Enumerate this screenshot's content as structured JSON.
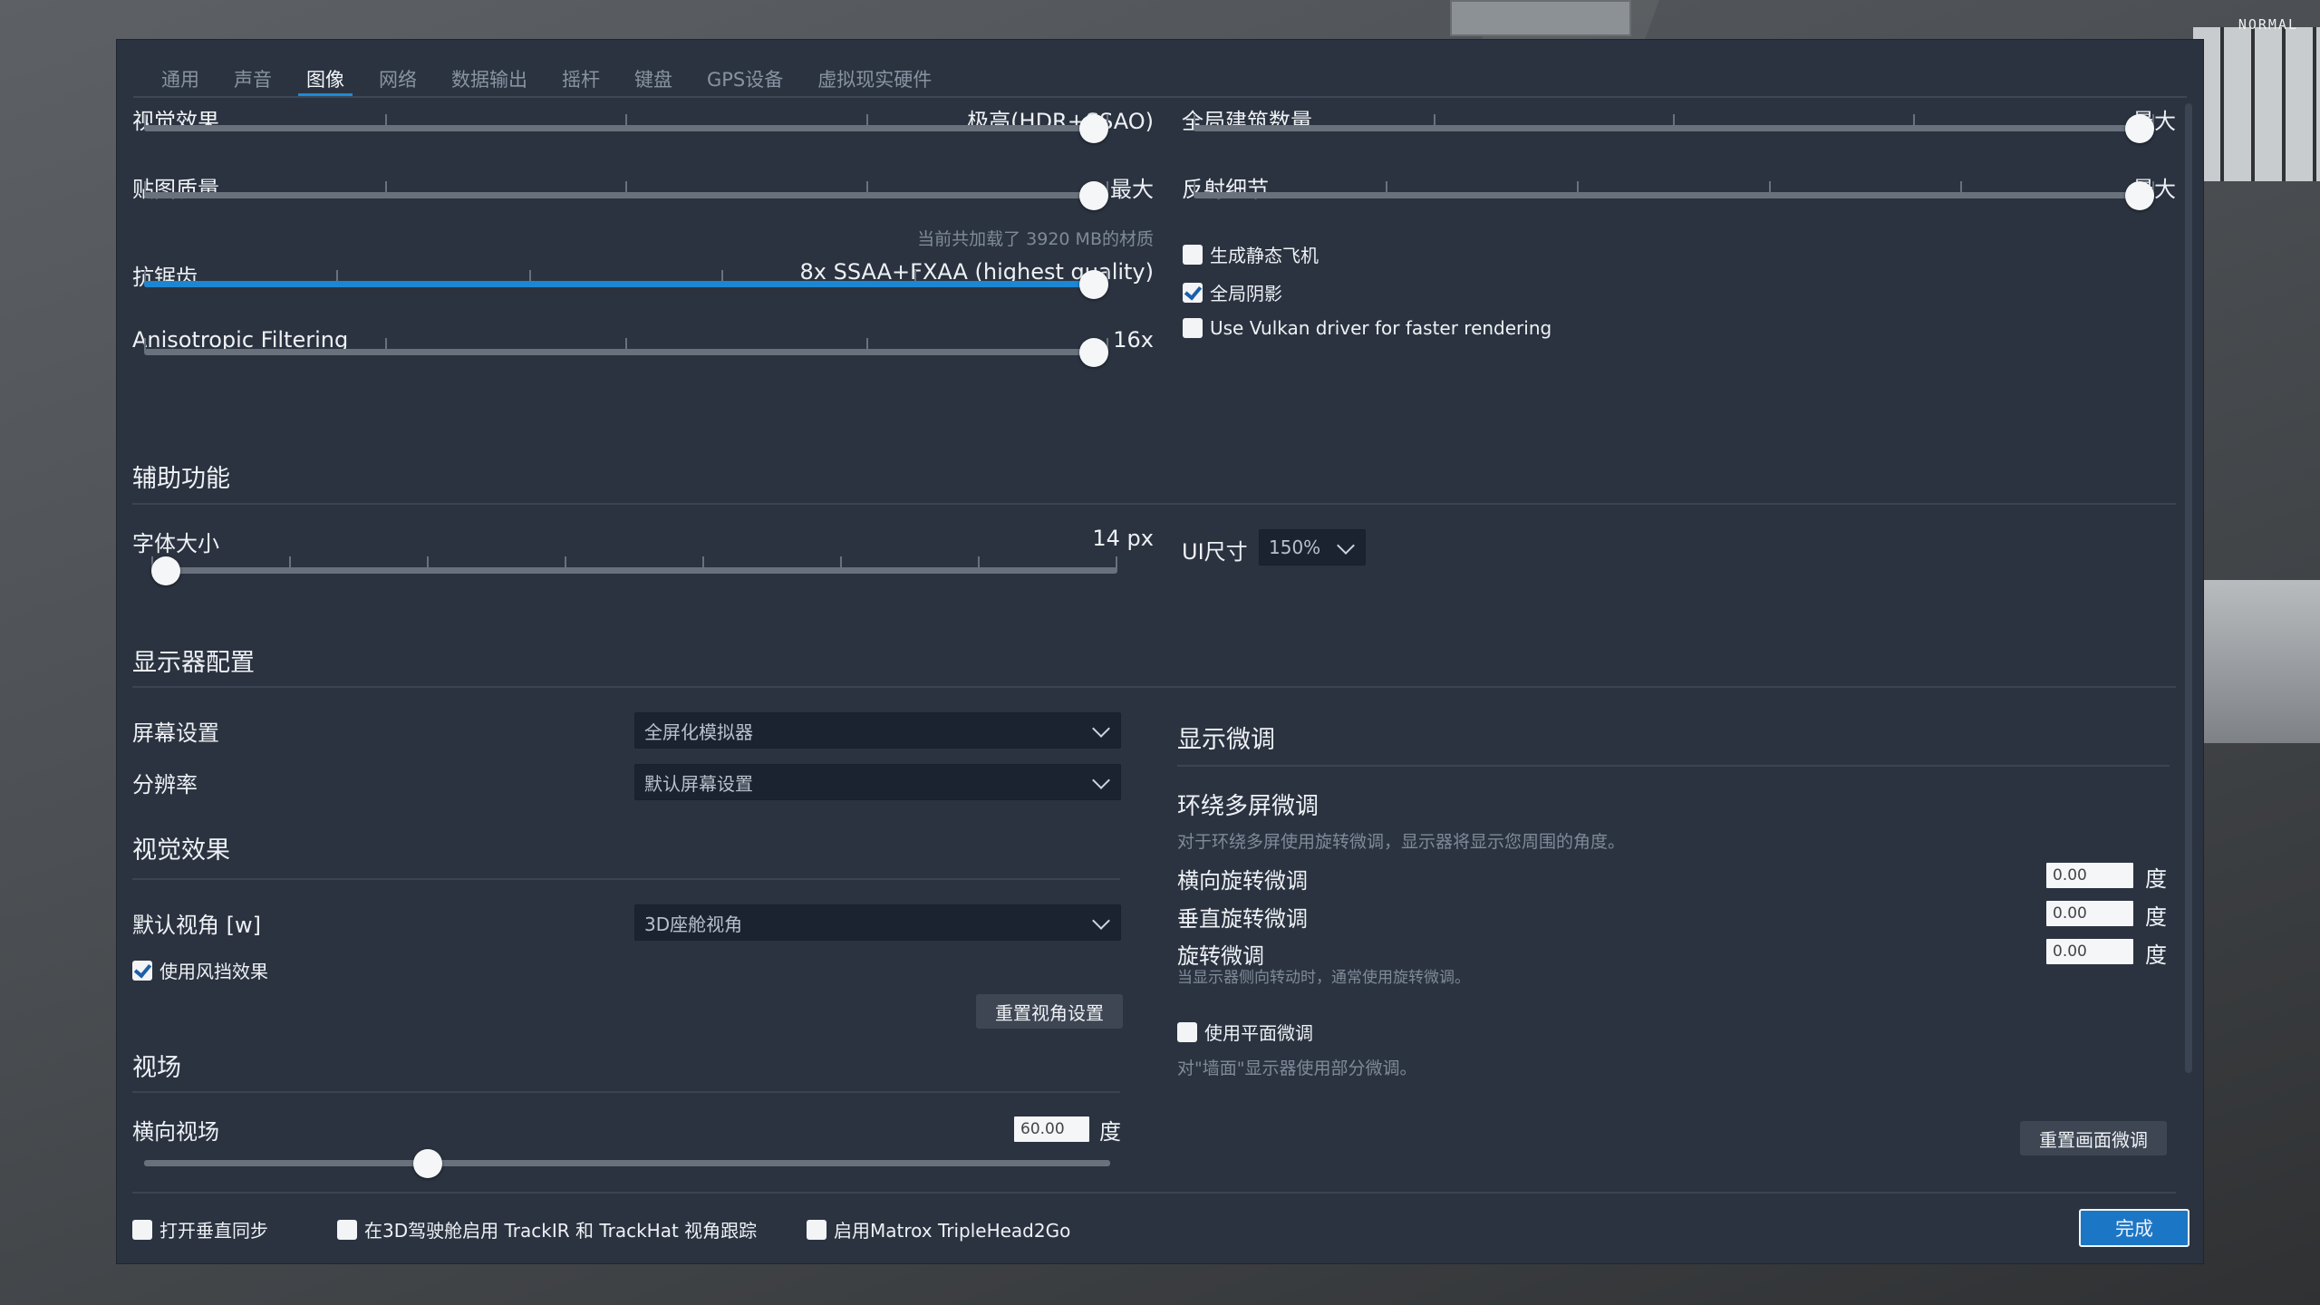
{
  "overlay_label": "NORMAL",
  "tabs": [
    "通用",
    "声音",
    "图像",
    "网络",
    "数据输出",
    "摇杆",
    "键盘",
    "GPS设备",
    "虚拟现实硬件"
  ],
  "active_tab": "图像",
  "graphics": {
    "visual_effects": {
      "label": "视觉效果",
      "value": "极高(HDR+SSAO)",
      "level": 1.0
    },
    "texture_quality": {
      "label": "贴图质量",
      "value": "最大",
      "level": 1.0
    },
    "texture_note": "当前共加载了 3920 MB的材质",
    "antialiasing": {
      "label": "抗锯齿",
      "value": "8x SSAA+FXAA (highest quality)",
      "level": 1.0
    },
    "anisotropic": {
      "label": "Anisotropic Filtering",
      "value": "16x",
      "level": 1.0
    },
    "world_objects": {
      "label": "全局建筑数量",
      "value": "最大",
      "level": 1.0
    },
    "reflection_detail": {
      "label": "反射细节",
      "value": "最大",
      "level": 1.0
    },
    "checks": [
      {
        "label": "生成静态飞机",
        "checked": false
      },
      {
        "label": "全局阴影",
        "checked": true
      },
      {
        "label": "Use Vulkan driver for faster rendering",
        "checked": false
      }
    ]
  },
  "accessibility": {
    "title": "辅助功能",
    "font_size": {
      "label": "字体大小",
      "value": "14 px",
      "level": 0.0
    },
    "ui_size": {
      "label": "UI尺寸",
      "value": "150%"
    }
  },
  "monitor": {
    "title": "显示器配置",
    "screen": {
      "label": "屏幕设置",
      "value": "全屏化模拟器"
    },
    "resolution": {
      "label": "分辨率",
      "value": "默认屏幕设置"
    },
    "visual_title": "视觉效果",
    "default_view": {
      "label": "默认视角 [w]",
      "value": "3D座舱视角"
    },
    "windshield": {
      "label": "使用风挡效果",
      "checked": true
    },
    "reset_view": "重置视角设置",
    "fov_title": "视场",
    "hfov": {
      "label": "横向视场",
      "value": "60.00",
      "unit": "度",
      "level": 0.294
    }
  },
  "tuning": {
    "title": "显示微调",
    "surround_title": "环绕多屏微调",
    "surround_note": "对于环绕多屏使用旋转微调，显示器将显示您周围的角度。",
    "rows": [
      {
        "label": "横向旋转微调",
        "value": "0.00",
        "unit": "度"
      },
      {
        "label": "垂直旋转微调",
        "value": "0.00",
        "unit": "度"
      },
      {
        "label": "旋转微调",
        "value": "0.00",
        "unit": "度"
      }
    ],
    "rotation_note": "当显示器侧向转动时，通常使用旋转微调。",
    "flat_check": {
      "label": "使用平面微调",
      "checked": false
    },
    "flat_note": "对\"墙面\"显示器使用部分微调。",
    "reset_button": "重置画面微调"
  },
  "footer": {
    "checks": [
      {
        "label": "打开垂直同步",
        "checked": false
      },
      {
        "label": "在3D驾驶舱启用 TrackIR 和 TrackHat 视角跟踪",
        "checked": false
      },
      {
        "label": "启用Matrox TripleHead2Go",
        "checked": false
      }
    ],
    "done": "完成"
  },
  "colors": {
    "panel": "#2b3340",
    "accent": "#1c86d3"
  }
}
